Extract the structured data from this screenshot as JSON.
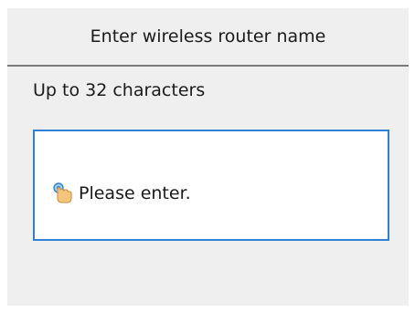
{
  "header": {
    "title": "Enter wireless router name"
  },
  "hint": {
    "text": "Up to 32 characters"
  },
  "input": {
    "placeholder": "Please enter.",
    "icon": "tap-finger-icon"
  },
  "colors": {
    "screen_background": "#efefef",
    "input_border": "#2f80d7",
    "divider": "#7a7a7a"
  }
}
